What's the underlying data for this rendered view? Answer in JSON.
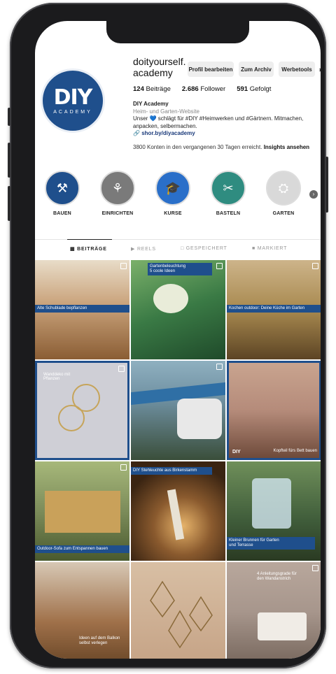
{
  "profile": {
    "username": "doityourself.\nacademy",
    "logo_text": "DIY",
    "logo_sub": "ACADEMY",
    "buttons": {
      "edit": "Profil bearbeiten",
      "archive": "Zum Archiv",
      "tools": "Werbetools"
    },
    "stats": {
      "posts_num": "124",
      "posts_label": "Beiträge",
      "followers_num": "2.686",
      "followers_label": "Follower",
      "following_num": "591",
      "following_label": "Gefolgt"
    },
    "bio": {
      "name": "DIY Academy",
      "category": "Heim- und Garten-Website",
      "text": "Unser 💙 schlägt für #DIY #Heimwerken und #Gärtnern. Mitmachen, anpacken, selbermachen.",
      "link": "shor.by/diyacademy"
    },
    "insights_text": "3800 Konten in den vergangenen 30 Tagen erreicht.",
    "insights_link": "Insights ansehen"
  },
  "highlights": [
    {
      "label": "BAUEN",
      "icon": "hammer-icon",
      "color": "#1f4f8c"
    },
    {
      "label": "EINRICHTEN",
      "icon": "shovel-icon",
      "color": "#7a7a7a"
    },
    {
      "label": "KURSE",
      "icon": "graduation-cap-icon",
      "color": "#2a6fc9"
    },
    {
      "label": "BASTELN",
      "icon": "scissors-icon",
      "color": "#2f8c80"
    },
    {
      "label": "GARTEN",
      "icon": "wheelbarrow-icon",
      "color": "#d9d9d9"
    }
  ],
  "tabs": [
    {
      "label": "BEITRÄGE",
      "icon": "grid-icon"
    },
    {
      "label": "REELS",
      "icon": "reels-icon"
    },
    {
      "label": "GESPEICHERT",
      "icon": "bookmark-icon"
    },
    {
      "label": "MARKIERT",
      "icon": "tag-icon"
    }
  ],
  "posts": [
    {
      "caption": "Alte Schublade bepflanzen",
      "color": "#c9a27a"
    },
    {
      "caption": "Gartenbeleuchtung\n5 coole Ideen",
      "color": "#3a7a45"
    },
    {
      "caption": "Kochen outdoor: Deine Küche im Garten",
      "color": "#a8894f"
    },
    {
      "caption": "Wanddeko mit\nPflanzen",
      "color": "#cfcfd6"
    },
    {
      "caption": "",
      "color": "#6e8fa0"
    },
    {
      "caption": "Kopfteil fürs Bett bauen",
      "color": "#b58b7a"
    },
    {
      "caption": "Outdoor-Sofa zum Entspannen bauen",
      "color": "#7c8c5a"
    },
    {
      "caption": "Stehleuchte aus Birkenstamm",
      "color": "#5a3a20"
    },
    {
      "caption": "Kleiner Brunnen für Garten\nund Terrasse",
      "color": "#3f5c3a"
    },
    {
      "caption": "Ideen auf dem Balkon\nselbst verlegen",
      "color": "#a0714a"
    },
    {
      "caption": "",
      "color": "#c6a487"
    },
    {
      "caption": "4 Anleitungsgrade für\nden Wandanstrich",
      "color": "#a7968c"
    }
  ]
}
